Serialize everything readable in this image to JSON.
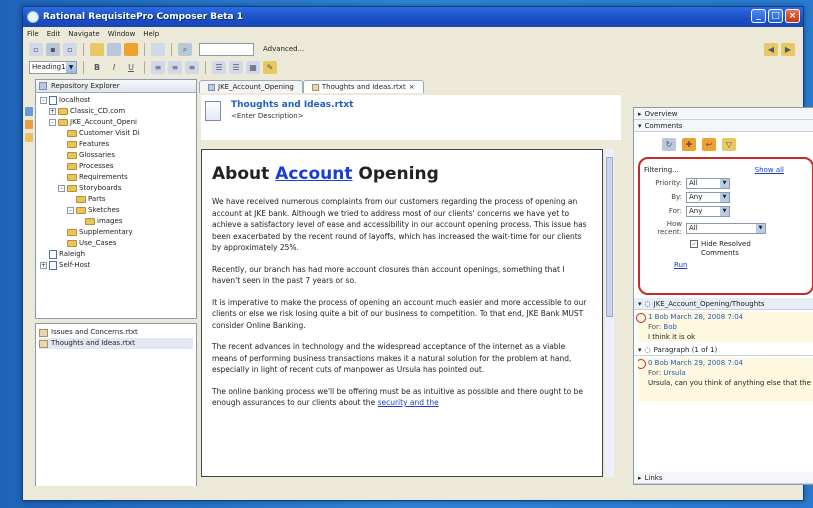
{
  "window": {
    "title": "Rational RequisitePro Composer Beta 1"
  },
  "menu": [
    "File",
    "Edit",
    "Navigate",
    "Window",
    "Help"
  ],
  "toolbar": {
    "advanced_label": "Advanced...",
    "style_value": "Heading1",
    "bold": "B",
    "italic": "I",
    "underline": "U"
  },
  "repo": {
    "tab_label": "Repository Explorer",
    "tree": [
      {
        "label": "localhost",
        "indent": 0,
        "kind": "proj",
        "pm": "-"
      },
      {
        "label": "Classic_CD.com",
        "indent": 1,
        "kind": "fold",
        "pm": "+"
      },
      {
        "label": "JKE_Account_Openi",
        "indent": 1,
        "kind": "fold",
        "pm": "-"
      },
      {
        "label": "Customer Visit Di",
        "indent": 2,
        "kind": "fold",
        "pm": ""
      },
      {
        "label": "Features",
        "indent": 2,
        "kind": "fold",
        "pm": ""
      },
      {
        "label": "Glossaries",
        "indent": 2,
        "kind": "fold",
        "pm": ""
      },
      {
        "label": "Processes",
        "indent": 2,
        "kind": "fold",
        "pm": ""
      },
      {
        "label": "Requirements",
        "indent": 2,
        "kind": "fold",
        "pm": ""
      },
      {
        "label": "Storyboards",
        "indent": 2,
        "kind": "fold",
        "pm": "-"
      },
      {
        "label": "Parts",
        "indent": 3,
        "kind": "fold",
        "pm": ""
      },
      {
        "label": "Sketches",
        "indent": 3,
        "kind": "fold",
        "pm": "-"
      },
      {
        "label": "images",
        "indent": 4,
        "kind": "fold",
        "pm": ""
      },
      {
        "label": "Supplementary",
        "indent": 2,
        "kind": "fold",
        "pm": ""
      },
      {
        "label": "Use_Cases",
        "indent": 2,
        "kind": "fold",
        "pm": ""
      },
      {
        "label": "Raleigh",
        "indent": 0,
        "kind": "proj",
        "pm": ""
      },
      {
        "label": "Self-Host",
        "indent": 0,
        "kind": "proj",
        "pm": "+"
      }
    ],
    "files": [
      "Issues and Concerns.rtxt",
      "Thoughts and Ideas.rtxt"
    ]
  },
  "editor": {
    "tabs": [
      "JKE_Account_Opening",
      "Thoughts and Ideas.rtxt"
    ],
    "doc_title": "Thoughts and Ideas.rtxt",
    "doc_desc": "<Enter Description>",
    "heading_pre": "About ",
    "heading_link": "Account",
    "heading_post": " Opening",
    "paras": [
      "We have received numerous complaints from our customers regarding the process of opening an account at JKE bank.  Although we tried to address most of our clients' concerns we have yet to achieve a satisfactory level of ease and accessibility in our account opening process. This issue has been exacerbated by the recent round of layoffs, which has increased the wait-time for our clients by approximately 25%.",
      "Recently, our branch has had more account closures than account openings, something that I haven't seen in the past 7 years or so.",
      "It is imperative to make the process of opening an account much easier and more accessible to our clients or else we risk losing quite a bit of our business to competition.  To that end, JKE Bank MUST consider Online Banking.",
      "The recent advances in technology and the widespread acceptance of the internet as a viable means of performing business transactions makes it a natural solution for the problem at hand, especially in light of recent cuts of manpower as Ursula has pointed out."
    ],
    "last_para": "The online banking process we'll be offering must be as intuitive as possible and there ought to be enough assurances to our clients about the ",
    "last_link": "security and the"
  },
  "right": {
    "overview": "Overview",
    "comments": "Comments",
    "filtering": "Filtering...",
    "show_all": "Show all",
    "priority_label": "Priority:",
    "priority": "All",
    "by_label": "By:",
    "by": "Any",
    "for_label": "For:",
    "for": "Any",
    "how_label1": "How",
    "how_label2": "recent:",
    "how": "All",
    "hide_resolved": "Hide Resolved Comments",
    "run": "Run",
    "thread": "JKE_Account_Opening/Thoughts",
    "c1_head": "1  Bob  March 28, 2008 7:04",
    "c1_for": "Bob",
    "c1_text": "I think it is ok",
    "paragraph": "Paragraph (1 of 1)",
    "c2_head": "0  Bob  March 29, 2008 7:04",
    "c2_for": "Ursula",
    "c2_text": "Ursula, can you think of anything else that the",
    "links": "Links"
  },
  "colors": {
    "accent": "#1a3fd0",
    "highlight": "#c82828",
    "titlebar": "#1b4fc4"
  }
}
